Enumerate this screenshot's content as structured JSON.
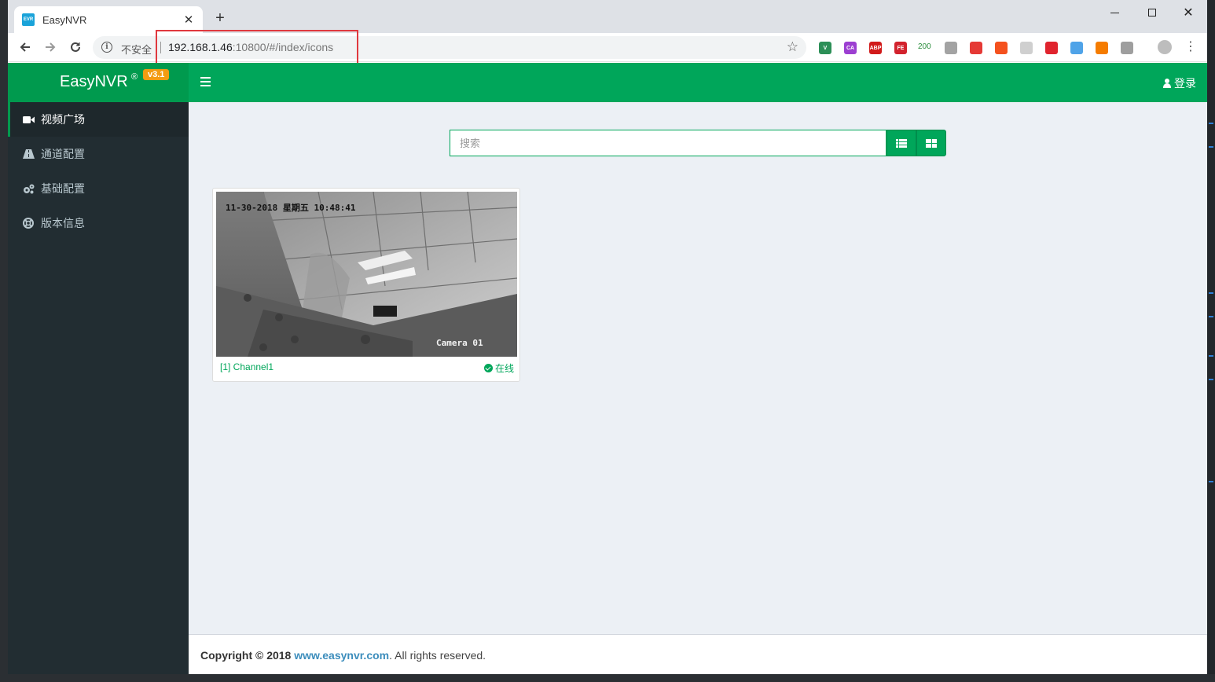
{
  "browser": {
    "tab_title": "EasyNVR",
    "tab_favicon_text": "EVR",
    "tab_close": "✕",
    "new_tab": "+",
    "insecure_label": "不安全",
    "url_host": "192.168.1.46",
    "url_rest": ":10800/#/index/icons",
    "extensions": [
      {
        "name": "vue-devtools-icon",
        "color": "#2c8f57",
        "text": "V"
      },
      {
        "name": "ca-extension-icon",
        "color": "#9c3fd1",
        "text": "CA"
      },
      {
        "name": "adblock-plus-icon",
        "color": "#d11a1a",
        "text": "ABP"
      },
      {
        "name": "fe-helper-icon",
        "color": "#d2222d",
        "text": "FE"
      },
      {
        "name": "status-200-extension",
        "text": "200"
      },
      {
        "name": "grey-extension-icon",
        "color": "#a3a3a3",
        "text": ""
      },
      {
        "name": "red-extension-icon",
        "color": "#e53935",
        "text": ""
      },
      {
        "name": "orange-extension-icon",
        "color": "#f4511e",
        "text": ""
      },
      {
        "name": "cat-extension-icon",
        "color": "#cfcfcf",
        "text": ""
      },
      {
        "name": "red-square-extension-icon",
        "color": "#e0242e",
        "text": ""
      },
      {
        "name": "blue-extension-icon",
        "color": "#4fa3e8",
        "text": ""
      },
      {
        "name": "orange-square-extension-icon",
        "color": "#f57c00",
        "text": ""
      },
      {
        "name": "document-search-extension-icon",
        "color": "#9e9e9e",
        "text": ""
      }
    ]
  },
  "app": {
    "brand": "EasyNVR",
    "registered": "®",
    "version": "v3.1",
    "menu": [
      {
        "label": "视频广场",
        "icon": "video-camera-icon"
      },
      {
        "label": "通道配置",
        "icon": "road-icon"
      },
      {
        "label": "基础配置",
        "icon": "cogs-icon"
      },
      {
        "label": "版本信息",
        "icon": "life-ring-icon"
      }
    ],
    "login": "登录",
    "search_placeholder": "搜索",
    "channel": {
      "name": "[1] Channel1",
      "status": "在线",
      "osd_time": "11-30-2018 星期五 10:48:41",
      "osd_camera": "Camera 01"
    },
    "footer": {
      "copyright": "Copyright © 2018",
      "link": "www.easynvr.com",
      "rest": ". All rights reserved."
    },
    "colors": {
      "header_green": "#00a65a",
      "logo_green": "#009a4e",
      "sidebar": "#222d32",
      "version_badge": "#f39c12",
      "link_blue": "#3c8dbc"
    }
  }
}
